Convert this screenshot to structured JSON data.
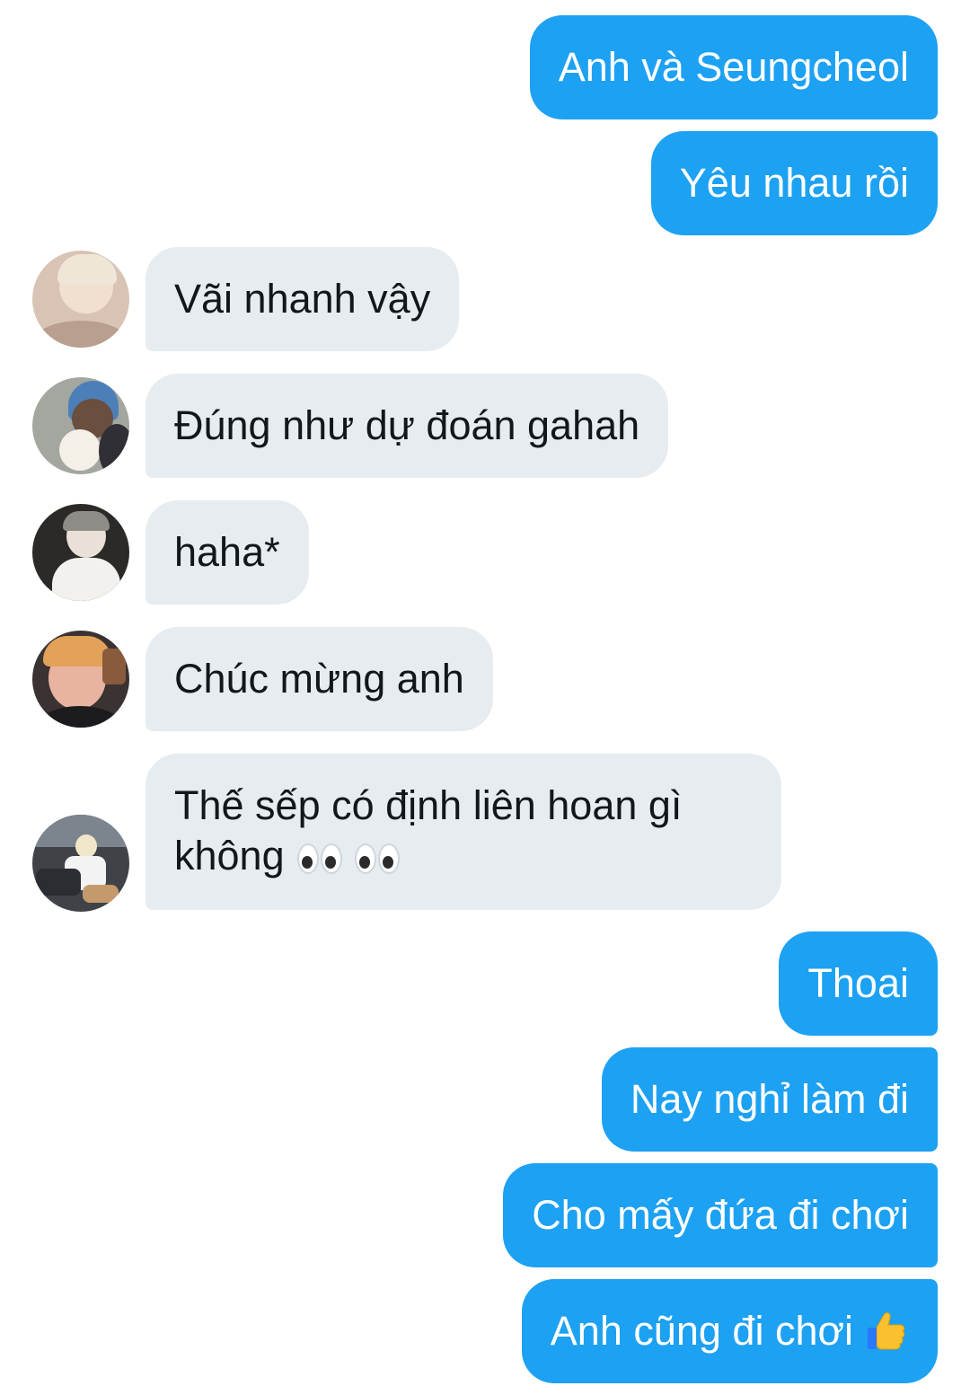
{
  "conversation": {
    "messages": [
      {
        "id": "m1",
        "direction": "outgoing",
        "text": "Anh và Seungcheol"
      },
      {
        "id": "m2",
        "direction": "outgoing",
        "text": "Yêu nhau rồi"
      },
      {
        "id": "m3",
        "direction": "incoming",
        "text": "Vãi nhanh vậy",
        "avatar_icon": "avatar-1-icon"
      },
      {
        "id": "m4",
        "direction": "incoming",
        "text": "Đúng như dự đoán gahah",
        "avatar_icon": "avatar-2-icon"
      },
      {
        "id": "m5",
        "direction": "incoming",
        "text": "haha*",
        "avatar_icon": "avatar-3-icon"
      },
      {
        "id": "m6",
        "direction": "incoming",
        "text": "Chúc mừng anh",
        "avatar_icon": "avatar-4-icon"
      },
      {
        "id": "m7",
        "direction": "incoming",
        "text": "Thế sếp có định liên hoan gì không",
        "emoji": "eyes-emoji",
        "avatar_icon": "avatar-5-icon"
      },
      {
        "id": "m8",
        "direction": "outgoing",
        "text": "Thoai"
      },
      {
        "id": "m9",
        "direction": "outgoing",
        "text": "Nay nghỉ làm đi"
      },
      {
        "id": "m10",
        "direction": "outgoing",
        "text": "Cho mấy đứa đi chơi"
      },
      {
        "id": "m11",
        "direction": "outgoing",
        "text": "Anh cũng đi chơi",
        "emoji": "thumbs-up-emoji"
      }
    ]
  },
  "colors": {
    "outgoing_bubble": "#1da1f2",
    "incoming_bubble": "#e6ecf0",
    "outgoing_text": "#ffffff",
    "incoming_text": "#14171a"
  }
}
